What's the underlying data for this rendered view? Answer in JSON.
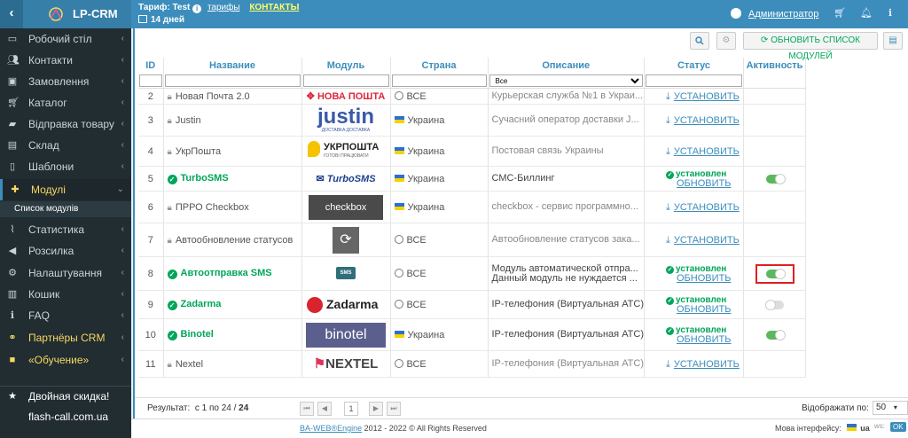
{
  "topbar": {
    "logo_text": "LP-CRM",
    "tariff_label": "Тариф:",
    "tariff_value": "Test",
    "tariffs_link": "тарифы",
    "contacts_link": "КОНТАКТЫ",
    "days": "14 дней",
    "user_name": "Администратор"
  },
  "sidebar": {
    "items": [
      {
        "label": "Робочий стіл",
        "icon": "monitor-icon"
      },
      {
        "label": "Контакти",
        "icon": "users-icon"
      },
      {
        "label": "Замовлення",
        "icon": "money-icon"
      },
      {
        "label": "Каталог",
        "icon": "cart-icon"
      },
      {
        "label": "Відправка товару",
        "icon": "truck-icon"
      },
      {
        "label": "Склад",
        "icon": "warehouse-icon"
      },
      {
        "label": "Шаблони",
        "icon": "file-icon"
      },
      {
        "label": "Модулі",
        "icon": "puzzle-icon"
      },
      {
        "label": "Статистика",
        "icon": "chart-icon"
      },
      {
        "label": "Розсилка",
        "icon": "megaphone-icon"
      },
      {
        "label": "Налаштування",
        "icon": "gear-icon"
      },
      {
        "label": "Кошик",
        "icon": "trash-icon"
      },
      {
        "label": "FAQ",
        "icon": "info-icon"
      },
      {
        "label": "Партнёры CRM",
        "icon": "handshake-icon"
      },
      {
        "label": "«Обучение»",
        "icon": "video-icon"
      },
      {
        "label": "Двойная скидка!",
        "icon": "star-icon"
      },
      {
        "label": "flash-call.com.ua",
        "icon": ""
      }
    ],
    "sub_item": "Список модулів"
  },
  "toolbar": {
    "refresh_label": "ОБНОВИТЬ СПИСОК МОДУЛЕЙ"
  },
  "table": {
    "headers": [
      "ID",
      "Название",
      "Модуль",
      "Страна",
      "Описание",
      "Статус",
      "Активность"
    ],
    "filter_select": "Все",
    "rows": [
      {
        "id": "2",
        "name": "Новая Почта 2.0",
        "logo": "НОВА ПОШТА",
        "country": "ВСЕ",
        "desc": "Курьерская служба №1 в Украи...",
        "status": "УСТАНОВИТЬ"
      },
      {
        "id": "3",
        "name": "Justin",
        "logo": "justin",
        "logo_sub": "ДОСТАВКА ДОСТАВКА",
        "country": "Украина",
        "desc": "Сучасний оператор доставки J...",
        "status": "УСТАНОВИТЬ"
      },
      {
        "id": "4",
        "name": "УкрПошта",
        "logo": "УКРПОШТА",
        "logo_sub": "ГОТОВІ ПРАЦЮВАТИ",
        "country": "Украина",
        "desc": "Постовая связь Украины",
        "status": "УСТАНОВИТЬ"
      },
      {
        "id": "5",
        "name": "TurboSMS",
        "logo": "TurboSMS",
        "country": "Украина",
        "desc": "СМС-Биллинг",
        "status": "установлен",
        "update": "ОБНОВИТЬ"
      },
      {
        "id": "6",
        "name": "ПРРО Checkbox",
        "logo": "checkbox",
        "country": "Украина",
        "desc": "checkbox - сервис программно...",
        "status": "УСТАНОВИТЬ"
      },
      {
        "id": "7",
        "name": "Автообновление статусов",
        "logo": "",
        "country": "ВСЕ",
        "desc": "Автообновление статусов зака...",
        "status": "УСТАНОВИТЬ"
      },
      {
        "id": "8",
        "name": "Автоотправка SMS",
        "logo": "SMS",
        "country": "ВСЕ",
        "desc": "Модуль автоматической отпра...",
        "desc2": "Данный модуль не нуждается ...",
        "status": "установлен",
        "update": "ОБНОВИТЬ"
      },
      {
        "id": "9",
        "name": "Zadarma",
        "logo": "Zadarma",
        "country": "ВСЕ",
        "desc": "IP-телефония (Виртуальная АТС)",
        "status": "установлен",
        "update": "ОБНОВИТЬ"
      },
      {
        "id": "10",
        "name": "Binotel",
        "logo": "binotel",
        "country": "Украина",
        "desc": "IP-телефония (Виртуальная АТС)",
        "status": "установлен",
        "update": "ОБНОВИТЬ"
      },
      {
        "id": "11",
        "name": "Nextel",
        "logo": "NEXTEL",
        "country": "ВСЕ",
        "desc": "IP-телефония (Виртуальная АТС)",
        "status": "УСТАНОВИТЬ"
      }
    ],
    "toggles": {
      "5": 1,
      "8": 1,
      "9": 0,
      "10": 1
    }
  },
  "pager": {
    "result_label": "Результат:",
    "result_range": "с 1 по 24 /",
    "result_total": "24",
    "page": "1",
    "show_label": "Відображати по:",
    "per_page": "50"
  },
  "footer": {
    "brand_link": "BA-WEB®Engine",
    "copyright": " 2012 - 2022 © All Rights Reserved",
    "lang_label": "Мова інтерфейсу:",
    "lang": "ua",
    "ws": "ws:",
    "ok": "OK"
  }
}
